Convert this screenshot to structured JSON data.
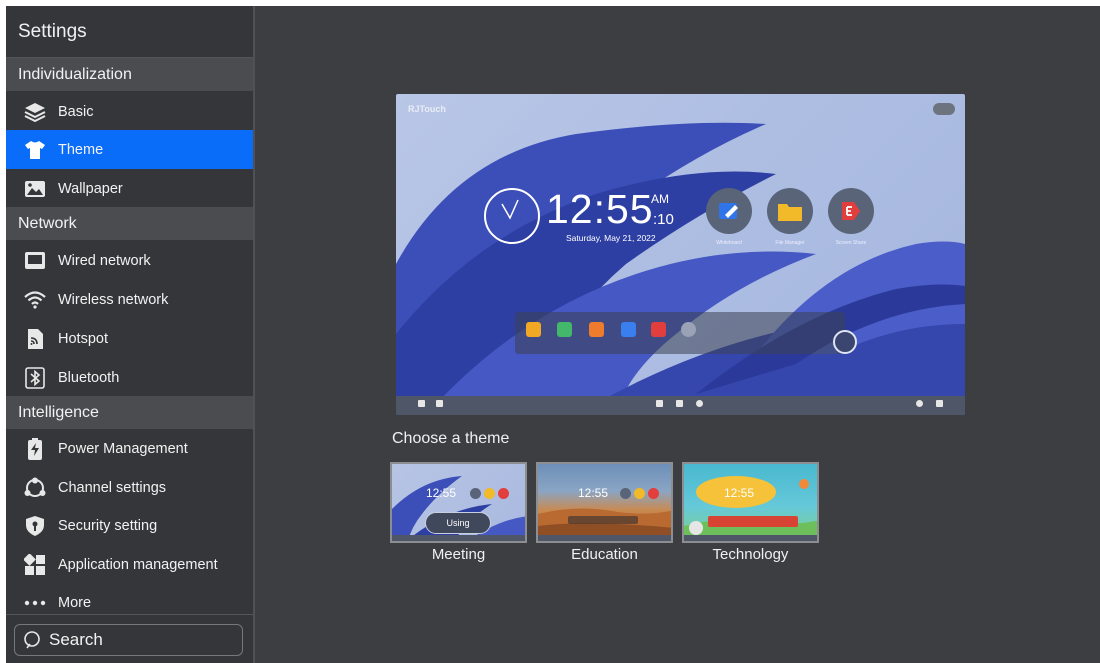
{
  "sidebar": {
    "title": "Settings",
    "sections": {
      "individualization": "Individualization",
      "network": "Network",
      "intelligence": "Intelligence"
    },
    "items": [
      {
        "label": "Basic",
        "icon": "layers-icon"
      },
      {
        "label": "Theme",
        "icon": "tshirt-icon",
        "active": true
      },
      {
        "label": "Wallpaper",
        "icon": "image-icon"
      },
      {
        "label": "Wired network",
        "icon": "monitor-icon"
      },
      {
        "label": "Wireless network",
        "icon": "wifi-icon"
      },
      {
        "label": "Hotspot",
        "icon": "hotspot-icon"
      },
      {
        "label": "Bluetooth",
        "icon": "bluetooth-icon"
      },
      {
        "label": "Power Management",
        "icon": "battery-icon"
      },
      {
        "label": "Channel settings",
        "icon": "channel-icon"
      },
      {
        "label": "Security setting",
        "icon": "shield-icon"
      },
      {
        "label": "Application management",
        "icon": "apps-grid-icon"
      },
      {
        "label": "More",
        "icon": "more-dots-icon"
      }
    ],
    "search": {
      "label": "Search"
    }
  },
  "preview": {
    "brand": "RJTouch",
    "time": "12:55",
    "ampm": "AM",
    "seconds": ":10",
    "date": "Saturday, May 21, 2022",
    "apps": [
      "Whiteboard",
      "File Manager",
      "Screen Share"
    ]
  },
  "themes": {
    "heading": "Choose a theme",
    "options": [
      {
        "name": "Meeting",
        "status": "Using",
        "mini_time": "12:55"
      },
      {
        "name": "Education",
        "mini_time": "12:55"
      },
      {
        "name": "Technology",
        "mini_time": "12:55"
      }
    ]
  },
  "colors": {
    "accent": "#0a6dfa",
    "sidebar_bg": "#353639",
    "content_bg": "#3d3e42"
  }
}
